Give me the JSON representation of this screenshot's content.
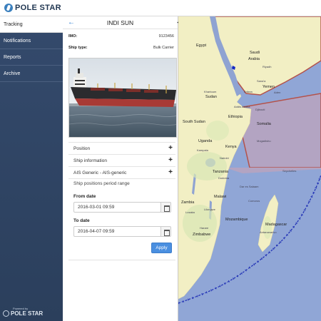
{
  "brand": {
    "name": "POLE STAR"
  },
  "nav": {
    "items": [
      {
        "label": "Tracking",
        "active": true
      },
      {
        "label": "Notifications",
        "active": false
      },
      {
        "label": "Reports",
        "active": false
      },
      {
        "label": "Archive",
        "active": false
      }
    ],
    "footer_powered": "Powered by",
    "footer_brand": "POLE STAR"
  },
  "panel": {
    "title": "INDI SUN",
    "imo_label": "IMO:",
    "imo_value": "9123456",
    "type_label": "Ship type:",
    "type_value": "Bulk Carrier",
    "accordions": [
      {
        "label": "Position"
      },
      {
        "label": "Ship information"
      },
      {
        "label": "AIS Generic - AIS-generic"
      },
      {
        "label": "Ship positions period range"
      }
    ],
    "from_label": "From date",
    "from_value": "2016-03-01 09:59",
    "to_label": "To date",
    "to_value": "2016-04-07 09:59",
    "apply_label": "Apply"
  },
  "map": {
    "labels": [
      "Egypt",
      "Saudi",
      "Arabia",
      "Yemen",
      "Khartoum",
      "Sudan",
      "Eritrea",
      "Ethiopia",
      "Djibouti",
      "South Sudan",
      "Somalia",
      "Uganda",
      "Kenya",
      "Nairobi",
      "Tanzania",
      "Dar es Salaam",
      "Malawi",
      "Zambia",
      "Mozambique",
      "Madagascar",
      "Seychelles",
      "Addis Ababa",
      "Sana'a",
      "Aden",
      "Mogadishu",
      "Kampala",
      "Dodoma",
      "Lilongwe",
      "Lusaka",
      "Harare",
      "Zimbabwe",
      "Comoros",
      "Antananarivo",
      "Riyadh"
    ],
    "colors": {
      "water": "#90a6d6",
      "land": "#f2efc4",
      "restricted_zone": "#b3a4c2",
      "route": "#1f2fb5"
    }
  }
}
